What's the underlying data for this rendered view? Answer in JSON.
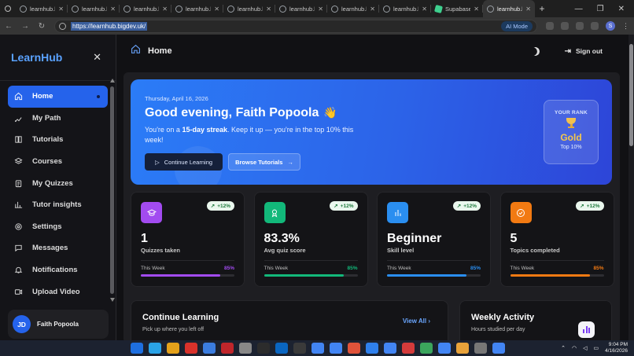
{
  "browser": {
    "tabs": [
      {
        "label": "learnhub.b",
        "kind": "globe"
      },
      {
        "label": "learnhub.b",
        "kind": "globe"
      },
      {
        "label": "learnhub.b",
        "kind": "globe"
      },
      {
        "label": "learnhub.b",
        "kind": "globe"
      },
      {
        "label": "learnhub.b",
        "kind": "globe"
      },
      {
        "label": "learnhub.b",
        "kind": "globe"
      },
      {
        "label": "learnhub.b",
        "kind": "globe"
      },
      {
        "label": "learnhub.b",
        "kind": "globe"
      },
      {
        "label": "Supabase",
        "kind": "supabase"
      },
      {
        "label": "learnhub.b",
        "kind": "globe",
        "active": true
      }
    ],
    "new_tab": "+",
    "url": "https://learnhub.bigdev.uk/",
    "ai_mode": "AI Mode",
    "profile_initial": "S"
  },
  "sidebar": {
    "brand": "LearnHub",
    "close": "✕",
    "items": [
      {
        "label": "Home",
        "icon": "home-icon",
        "active": true
      },
      {
        "label": "My Path",
        "icon": "path-icon"
      },
      {
        "label": "Tutorials",
        "icon": "book-icon"
      },
      {
        "label": "Courses",
        "icon": "layers-icon"
      },
      {
        "label": "My Quizzes",
        "icon": "clipboard-icon"
      },
      {
        "label": "Tutor insights",
        "icon": "chart-icon"
      },
      {
        "label": "Settings",
        "icon": "gear-icon"
      },
      {
        "label": "Messages",
        "icon": "message-icon"
      },
      {
        "label": "Notifications",
        "icon": "bell-icon"
      },
      {
        "label": "Upload Video",
        "icon": "video-icon"
      }
    ],
    "user": {
      "initials": "JD",
      "name": "Faith Popoola"
    }
  },
  "header": {
    "title": "Home",
    "signout": "Sign out"
  },
  "hero": {
    "date": "Thursday, April 16, 2026",
    "greeting": "Good evening, Faith Popoola",
    "wave": "👋",
    "streak_prefix": "You're on a ",
    "streak_bold": "15-day streak",
    "streak_suffix": ". Keep it up — you're in the top 10% this week!",
    "continue_label": "Continue Learning",
    "browse_label": "Browse Tutorials",
    "rank_label": "YOUR RANK",
    "rank_value": "Gold",
    "rank_sub": "Top 10%"
  },
  "stats": [
    {
      "value": "1",
      "label": "Quizzes taken",
      "trend": "+12%",
      "week": "This Week",
      "pct": "85%",
      "progress": 0.85,
      "color": "#a24bf0",
      "icon": "graduation-cap-icon"
    },
    {
      "value": "83.3%",
      "label": "Avg quiz score",
      "trend": "+12%",
      "week": "This Week",
      "pct": "85%",
      "progress": 0.85,
      "color": "#12b87a",
      "icon": "award-icon"
    },
    {
      "value": "Beginner",
      "label": "Skill level",
      "trend": "+12%",
      "week": "This Week",
      "pct": "85%",
      "progress": 0.85,
      "color": "#2a8ef0",
      "icon": "bar-chart-icon"
    },
    {
      "value": "5",
      "label": "Topics completed",
      "trend": "+12%",
      "week": "This Week",
      "pct": "85%",
      "progress": 0.85,
      "color": "#f27a12",
      "icon": "check-circle-icon"
    }
  ],
  "continue_panel": {
    "title": "Continue Learning",
    "subtitle": "Pick up where you left off",
    "view_all": "View All"
  },
  "weekly_panel": {
    "title": "Weekly Activity",
    "subtitle": "Hours studied per day"
  },
  "taskbar": {
    "time": "9:04 PM",
    "date": "4/16/2026"
  }
}
